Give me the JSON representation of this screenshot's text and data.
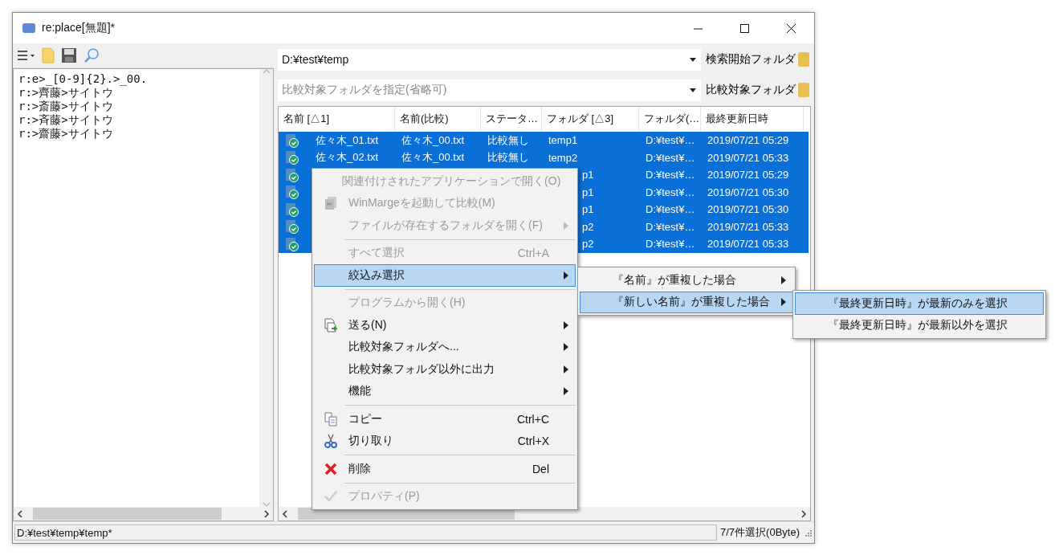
{
  "window": {
    "title": "re:place[無題]*"
  },
  "editor": {
    "lines": [
      "r:e>_[0-9]{2}.>_00.",
      "r:>齊藤>サイトウ",
      "r:>斎藤>サイトウ",
      "r:>斉藤>サイトウ",
      "r:>齋藤>サイトウ"
    ]
  },
  "search_folder": {
    "value": "D:¥test¥temp",
    "button": "検索開始フォルダ"
  },
  "compare_folder": {
    "placeholder": "比較対象フォルダを指定(省略可)",
    "button": "比較対象フォルダ"
  },
  "table": {
    "columns": [
      "名前 [△1]",
      "名前(比較)",
      "ステータ…",
      "フォルダ [△3]",
      "フォルダ(…",
      "最終更新日時"
    ],
    "rows": [
      {
        "selected": true,
        "name": "佐々木_01.txt",
        "compare_name": "佐々木_00.txt",
        "status": "比較無し",
        "folder": "temp1",
        "folder2": "D:¥test¥…",
        "modified": "2019/07/21 05:29"
      },
      {
        "selected": true,
        "name": "佐々木_02.txt",
        "compare_name": "佐々木_00.txt",
        "status": "比較無し",
        "folder": "temp2",
        "folder2": "D:¥test¥…",
        "modified": "2019/07/21 05:33"
      },
      {
        "selected": true,
        "folder": "p1",
        "folder2": "D:¥test¥…",
        "modified": "2019/07/21 05:29"
      },
      {
        "selected": true,
        "folder": "p1",
        "folder2": "D:¥test¥…",
        "modified": "2019/07/21 05:30"
      },
      {
        "selected": true,
        "folder": "p1",
        "folder2": "D:¥test¥…",
        "modified": "2019/07/21 05:30"
      },
      {
        "selected": true,
        "folder": "p2",
        "folder2": "D:¥test¥…",
        "modified": "2019/07/21 05:33"
      },
      {
        "selected": true,
        "folder": "p2",
        "folder2": "D:¥test¥…",
        "modified": "2019/07/21 05:33"
      }
    ]
  },
  "context_menu": {
    "items": [
      {
        "kind": "item",
        "label": "関連付けされたアプリケーションで開く(O)",
        "disabled": true,
        "submenu": false,
        "selected": false
      },
      {
        "kind": "item",
        "label": "WinMargeを起動して比較(M)",
        "disabled": true,
        "submenu": false,
        "selected": false
      },
      {
        "kind": "item",
        "label": "ファイルが存在するフォルダを開く(F)",
        "disabled": true,
        "submenu": true,
        "selected": false
      },
      {
        "kind": "separator"
      },
      {
        "kind": "item",
        "label": "すべて選択",
        "shortcut": "Ctrl+A",
        "disabled": true,
        "submenu": false,
        "selected": false
      },
      {
        "kind": "item",
        "label": "絞込み選択",
        "disabled": false,
        "submenu": true,
        "selected": true
      },
      {
        "kind": "separator"
      },
      {
        "kind": "item",
        "label": "プログラムから開く(H)",
        "disabled": true,
        "submenu": false,
        "selected": false
      },
      {
        "kind": "item",
        "label": "送る(N)",
        "disabled": false,
        "submenu": true,
        "selected": false
      },
      {
        "kind": "item",
        "label": "比較対象フォルダへ...",
        "disabled": false,
        "submenu": true,
        "selected": false
      },
      {
        "kind": "item",
        "label": "比較対象フォルダ以外に出力",
        "disabled": false,
        "submenu": true,
        "selected": false
      },
      {
        "kind": "item",
        "label": "機能",
        "disabled": false,
        "submenu": true,
        "selected": false
      },
      {
        "kind": "separator"
      },
      {
        "kind": "item",
        "label": "コピー",
        "shortcut": "Ctrl+C",
        "disabled": false,
        "submenu": false,
        "selected": false
      },
      {
        "kind": "item",
        "label": "切り取り",
        "shortcut": "Ctrl+X",
        "disabled": false,
        "submenu": false,
        "selected": false
      },
      {
        "kind": "separator"
      },
      {
        "kind": "item",
        "label": "削除",
        "shortcut": "Del",
        "disabled": false,
        "submenu": false,
        "selected": false
      },
      {
        "kind": "separator"
      },
      {
        "kind": "item",
        "label": "プロパティ(P)",
        "disabled": true,
        "submenu": false,
        "selected": false
      }
    ]
  },
  "submenu": {
    "items": [
      {
        "label": "『名前』が重複した場合",
        "submenu": true,
        "selected": false
      },
      {
        "label": "『新しい名前』が重複した場合",
        "submenu": true,
        "selected": true
      }
    ]
  },
  "submenu2": {
    "items": [
      {
        "label": "『最終更新日時』が最新のみを選択",
        "selected": true
      },
      {
        "label": "『最終更新日時』が最新以外を選択",
        "selected": false
      }
    ]
  },
  "status_bar": {
    "path": "D:¥test¥temp¥temp*",
    "selection": "7/7件選択(0Byte)"
  }
}
